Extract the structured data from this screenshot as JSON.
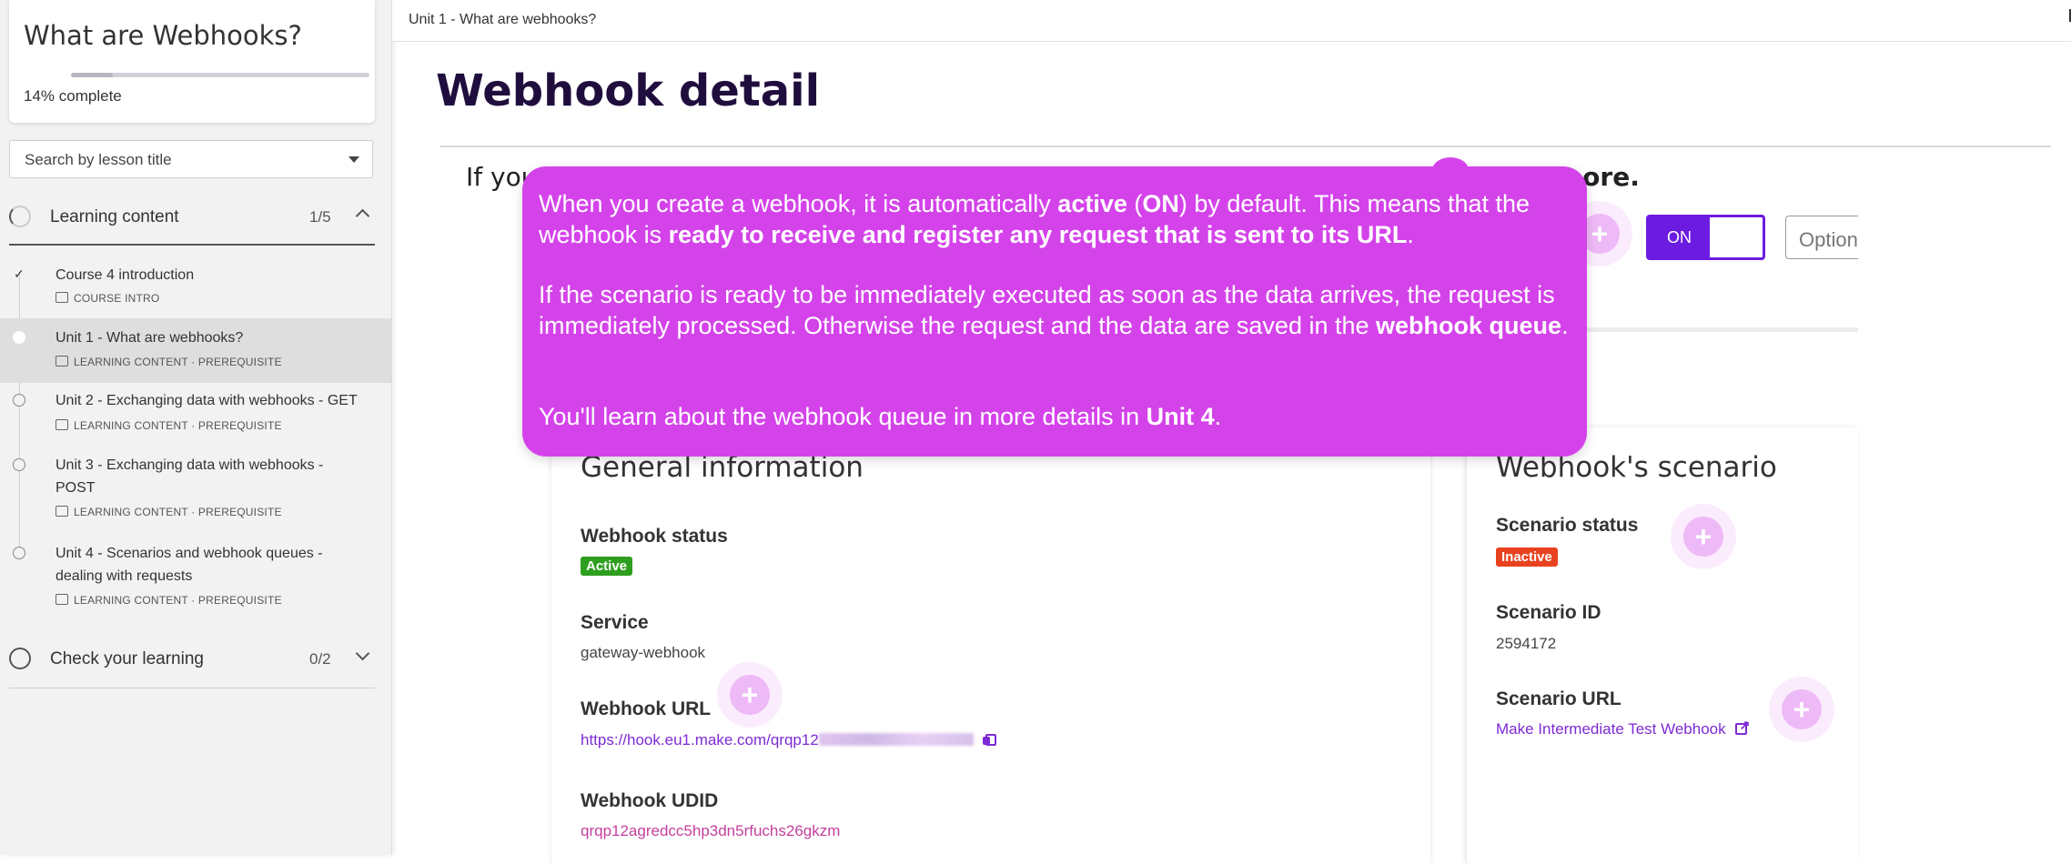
{
  "sidebar": {
    "course_title": "What are Webhooks?",
    "progress_percent": 14,
    "progress_value": "14%",
    "progress_suffix": "complete",
    "search_placeholder": "Search by lesson title",
    "sections": [
      {
        "label": "Learning content",
        "count": "1/5",
        "expanded": true,
        "lessons": [
          {
            "title": "Course 4 introduction",
            "meta": "COURSE INTRO",
            "completed": true
          },
          {
            "title": "Unit 1 - What are webhooks?",
            "meta": "LEARNING CONTENT · PREREQUISITE",
            "active": true
          },
          {
            "title": "Unit 2 - Exchanging data with webhooks - GET",
            "meta": "LEARNING CONTENT · PREREQUISITE"
          },
          {
            "title": "Unit 3 - Exchanging data with webhooks - POST",
            "meta": "LEARNING CONTENT · PREREQUISITE"
          },
          {
            "title": "Unit 4 - Scenarios and webhook queues - dealing with requests",
            "meta": "LEARNING CONTENT · PREREQUISITE"
          }
        ]
      },
      {
        "label": "Check your learning",
        "count": "0/2",
        "expanded": false
      }
    ]
  },
  "topbar": {
    "breadcrumb": "Unit 1 - What are webhooks?"
  },
  "main": {
    "title": "Webhook detail",
    "intro_fragment_left": "If you",
    "intro_fragment_right": "more.",
    "toggle_label": "ON",
    "options_label": "Option",
    "general": {
      "heading": "General information",
      "status_label": "Webhook status",
      "status_value": "Active",
      "service_label": "Service",
      "service_value": "gateway-webhook",
      "url_label": "Webhook URL",
      "url_value": "https://hook.eu1.make.com/qrqp12",
      "udid_label": "Webhook UDID",
      "udid_value": "qrqp12agredcc5hp3dn5rfuchs26gkzm"
    },
    "scenario": {
      "heading": "Webhook's scenario",
      "status_label": "Scenario status",
      "status_value": "Inactive",
      "id_label": "Scenario ID",
      "id_value": "2594172",
      "url_label": "Scenario URL",
      "url_value": "Make Intermediate Test Webhook"
    }
  },
  "tooltip": {
    "p1_a": "When you create a webhook, it is automatically ",
    "p1_b": "active",
    "p1_c": " (",
    "p1_d": "ON",
    "p1_e": ") by default. This means that the webhook is ",
    "p1_f": "ready to receive and register any request that is sent to its URL",
    "p1_g": ".",
    "p2_a": "If the scenario is ready to be immediately executed as soon as the data arrives, the request is immediately processed. Otherwise the request and the data are saved in the ",
    "p2_b": "webhook queue",
    "p2_c": ".",
    "p3_a": "You'll learn about the webhook queue in more details in ",
    "p3_b": "Unit 4",
    "p3_c": "."
  },
  "colors": {
    "accent_purple": "#6c1ce0",
    "tooltip_magenta": "#d443ea",
    "active_green": "#2e9e1e",
    "inactive_red": "#e8421e",
    "title_navy": "#1f0e3d"
  }
}
